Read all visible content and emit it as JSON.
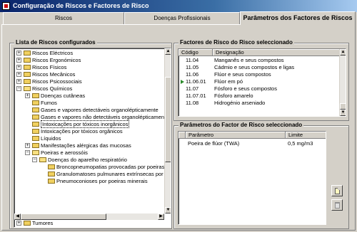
{
  "window": {
    "title": "Configuração de Riscos e Factores de Risco"
  },
  "tabs": [
    {
      "label": "Riscos"
    },
    {
      "label": "Doenças Profissionais"
    },
    {
      "label": "Parâmetros dos Factores de Riscos"
    }
  ],
  "risk_list": {
    "title": "Lista de Riscos configurados",
    "items": [
      "Riscos Eléctricos",
      "Riscos Ergonómicos",
      "Riscos Físicos",
      "Riscos Mecânicos",
      "Riscos Psicossociais",
      "Riscos Químicos",
      "Doenças cutâneas",
      "Fumos",
      "Gases e vapores detectáveis organolépticamente",
      "Gases e vapores não detectáveis organolépticamente",
      "Intoxicações por tóxicos inorgânicos",
      "Intoxicações por tóxicos orgânicos",
      "Líquidos",
      "Manifestações alérgicas das mucosas",
      "Poeiras e aerossóis",
      "Doenças do aparelho respiratório",
      "Broncopneumopatias provocadas por poeiras",
      "Granulomatoses pulmunares extrínsecas por",
      "Pneumoconioses por poeiras minerais",
      "Tumores"
    ]
  },
  "factors": {
    "title": "Factores de Risco do Risco seleccionado",
    "col_code": "Código",
    "col_desc": "Designação",
    "rows": [
      {
        "code": "11.04",
        "desc": "Manganês e seus compostos"
      },
      {
        "code": "11.05",
        "desc": "Cádmio e seus compostos e ligas"
      },
      {
        "code": "11.06",
        "desc": "Flúor e seus compostos"
      },
      {
        "code": "11.06.01",
        "desc": "Flúor em pó"
      },
      {
        "code": "11.07",
        "desc": "Fósforo e seus compostos"
      },
      {
        "code": "11.07.01",
        "desc": "Fósforo amarelo"
      },
      {
        "code": "11.08",
        "desc": "Hidrogénio arseniado"
      }
    ]
  },
  "params": {
    "title": "Parâmetros do Factor de Risco seleccionado",
    "col_param": "Parâmetro",
    "col_limit": "Limite",
    "rows": [
      {
        "param": "Poeira de flúor (TWA)",
        "limit": "0,5 mg/m3"
      }
    ]
  },
  "icons": {
    "new": "new-document-icon",
    "delete": "trash-icon"
  }
}
